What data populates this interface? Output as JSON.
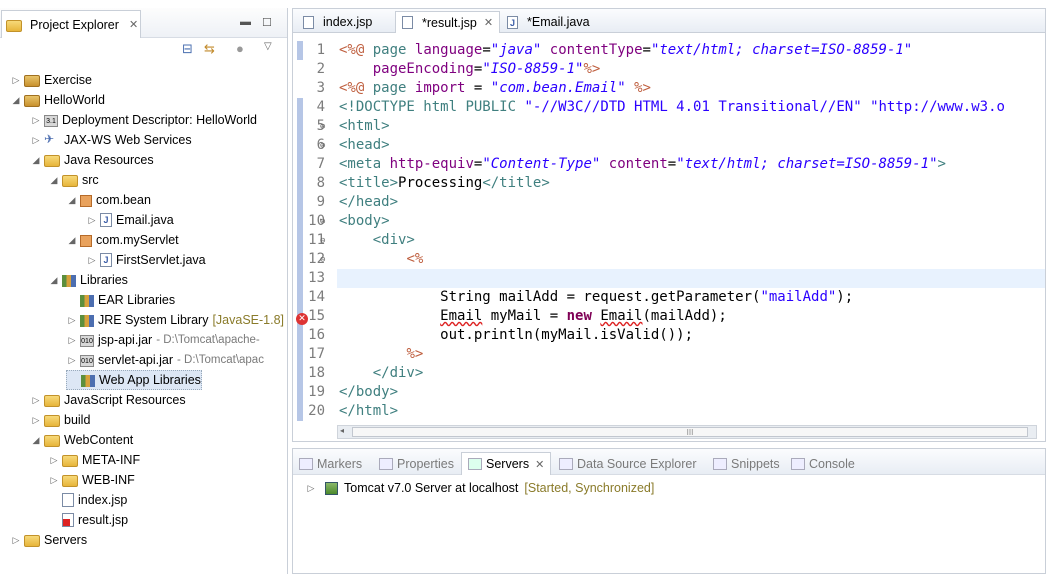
{
  "explorer": {
    "tab_label": "Project Explorer",
    "items": [
      {
        "label": "Exercise",
        "suffix": ""
      },
      {
        "label": "HelloWorld",
        "suffix": ""
      },
      {
        "label": "Deployment Descriptor: HelloWorld",
        "suffix": ""
      },
      {
        "label": "JAX-WS Web Services",
        "suffix": ""
      },
      {
        "label": "Java Resources",
        "suffix": ""
      },
      {
        "label": "src",
        "suffix": ""
      },
      {
        "label": "com.bean",
        "suffix": ""
      },
      {
        "label": "Email.java",
        "suffix": ""
      },
      {
        "label": "com.myServlet",
        "suffix": ""
      },
      {
        "label": "FirstServlet.java",
        "suffix": ""
      },
      {
        "label": "Libraries",
        "suffix": ""
      },
      {
        "label": "EAR Libraries",
        "suffix": ""
      },
      {
        "label": "JRE System Library",
        "suffix": "[JavaSE-1.8]"
      },
      {
        "label": "jsp-api.jar",
        "suffix": "- D:\\Tomcat\\apache-"
      },
      {
        "label": "servlet-api.jar",
        "suffix": "- D:\\Tomcat\\apac"
      },
      {
        "label": "Web App Libraries",
        "suffix": ""
      },
      {
        "label": "JavaScript Resources",
        "suffix": ""
      },
      {
        "label": "build",
        "suffix": ""
      },
      {
        "label": "WebContent",
        "suffix": ""
      },
      {
        "label": "META-INF",
        "suffix": ""
      },
      {
        "label": "WEB-INF",
        "suffix": ""
      },
      {
        "label": "index.jsp",
        "suffix": ""
      },
      {
        "label": "result.jsp",
        "suffix": ""
      },
      {
        "label": "Servers",
        "suffix": ""
      }
    ]
  },
  "editor": {
    "tabs": [
      {
        "label": "index.jsp"
      },
      {
        "label": "*result.jsp"
      },
      {
        "label": "*Email.java"
      }
    ],
    "line_numbers": [
      "1",
      "2",
      "3",
      "4",
      "5",
      "6",
      "7",
      "8",
      "9",
      "10",
      "11",
      "12",
      "13",
      "14",
      "15",
      "16",
      "17",
      "18",
      "19",
      "20"
    ],
    "hscroll_grip": "III"
  },
  "bottom": {
    "tabs": [
      {
        "label": "Markers"
      },
      {
        "label": "Properties"
      },
      {
        "label": "Servers"
      },
      {
        "label": "Data Source Explorer"
      },
      {
        "label": "Snippets"
      },
      {
        "label": "Console"
      }
    ],
    "server_name": "Tomcat v7.0 Server at localhost",
    "server_status": "[Started, Synchronized]"
  },
  "colors": {
    "keyword": "#7f0055",
    "tag": "#3f7f7f",
    "string": "#2a00ff",
    "jsp": "#bf5f3f"
  }
}
